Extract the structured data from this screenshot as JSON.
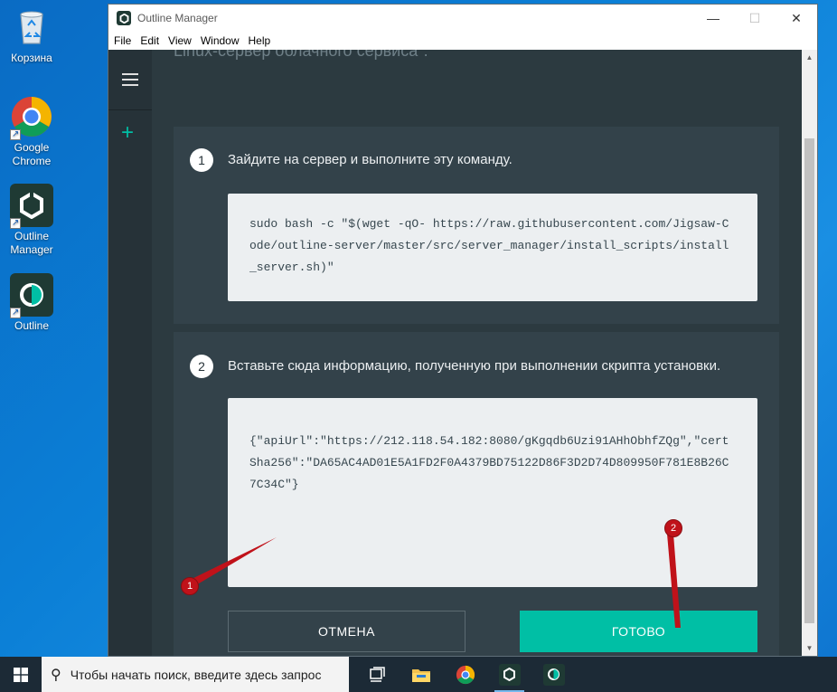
{
  "desktop": {
    "icons": [
      {
        "label": "Корзина",
        "icon": "recycle-bin-icon"
      },
      {
        "label": "Google Chrome",
        "icon": "chrome-icon"
      },
      {
        "label": "Outline Manager",
        "icon": "outline-manager-icon"
      },
      {
        "label": "Outline",
        "icon": "outline-client-icon"
      }
    ]
  },
  "window": {
    "title": "Outline Manager",
    "controls": {
      "minimize": "—",
      "maximize": "☐",
      "close": "✕"
    },
    "menu": [
      "File",
      "Edit",
      "View",
      "Window",
      "Help"
    ]
  },
  "sidebar": {
    "menu_icon": "hamburger-icon",
    "add_icon": "plus-icon"
  },
  "content": {
    "top_text": "Linux-сервер облачного сервиса\".",
    "step1": {
      "number": "1",
      "text": "Зайдите на сервер и выполните эту команду.",
      "command": "sudo bash -c \"$(wget -qO- https://raw.githubusercontent.com/Jigsaw-Code/outline-server/master/src/server_manager/install_scripts/install_server.sh)\""
    },
    "step2": {
      "number": "2",
      "text": "Вставьте сюда информацию, полученную при выполнении скрипта установки.",
      "pasted": "{\"apiUrl\":\"https://212.118.54.182:8080/gKgqdb6Uzi91AHhObhfZQg\",\"certSha256\":\"DA65AC4AD01E5A1FD2F0A4379BD75122D86F3D2D74D809950F781E8B26C7C34C\"}"
    },
    "cancel_label": "ОТМЕНА",
    "done_label": "ГОТОВО"
  },
  "annotations": {
    "marker1": "1",
    "marker2": "2"
  },
  "taskbar": {
    "search_placeholder": "Чтобы начать поиск, введите здесь запрос",
    "items": [
      "task-view-icon",
      "file-explorer-icon",
      "chrome-icon",
      "outline-manager-icon",
      "outline-client-icon"
    ]
  },
  "colors": {
    "accent": "#00bfa5",
    "window_bg": "#263238",
    "card_bg": "#33424a",
    "marker": "#c0121a"
  }
}
